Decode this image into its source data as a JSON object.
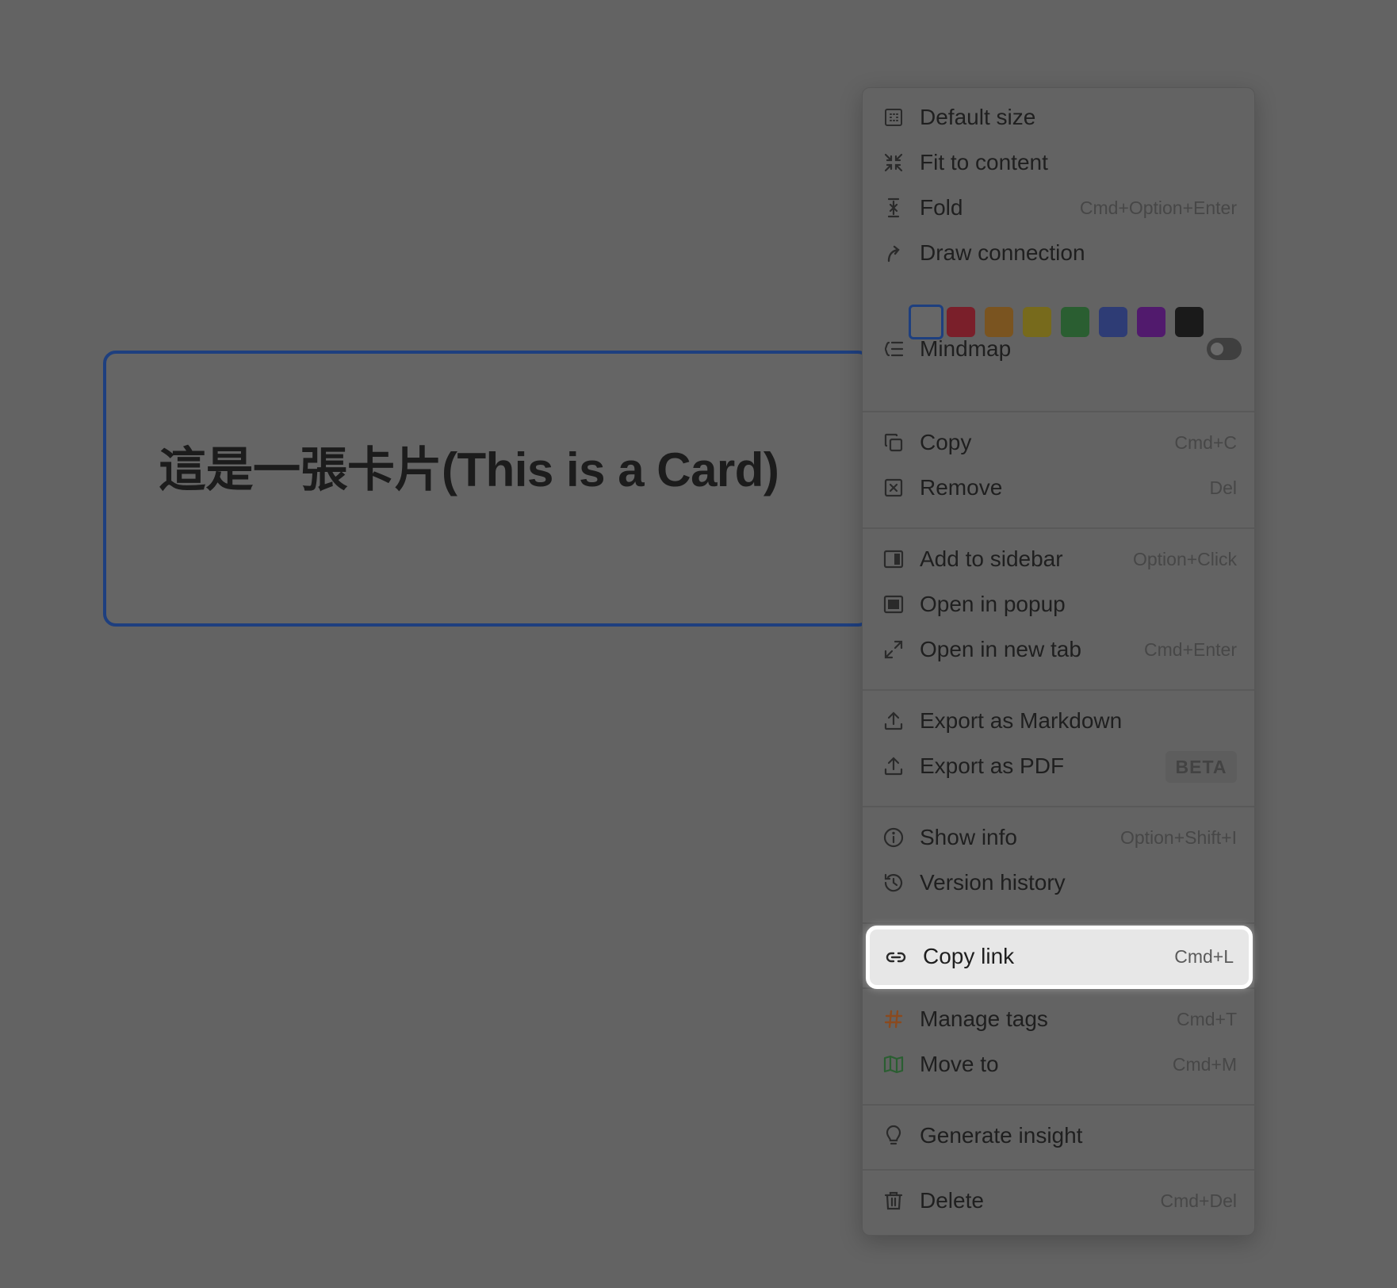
{
  "card": {
    "title": "這是一張卡片(This is a Card)"
  },
  "menu": {
    "default_size": {
      "label": "Default size",
      "icon": "grid-size-icon"
    },
    "fit_to_content": {
      "label": "Fit to content",
      "icon": "compress-icon"
    },
    "fold": {
      "label": "Fold",
      "shortcut": "Cmd+Option+Enter",
      "icon": "fold-icon"
    },
    "draw_connection": {
      "label": "Draw connection",
      "icon": "curved-arrow-icon"
    },
    "colors": [
      "#676767",
      "#7a1f2a",
      "#7a5420",
      "#776a1c",
      "#2a5e31",
      "#2e3c75",
      "#511a6d",
      "#1a1a1a"
    ],
    "selected_color_index": 0,
    "mindmap": {
      "label": "Mindmap",
      "icon": "mindmap-icon",
      "enabled": false
    },
    "copy": {
      "label": "Copy",
      "shortcut": "Cmd+C",
      "icon": "copy-icon"
    },
    "remove": {
      "label": "Remove",
      "shortcut": "Del",
      "icon": "remove-box-icon"
    },
    "add_to_sidebar": {
      "label": "Add to sidebar",
      "shortcut": "Option+Click",
      "icon": "sidebar-icon"
    },
    "open_in_popup": {
      "label": "Open in popup",
      "icon": "popup-icon"
    },
    "open_in_new_tab": {
      "label": "Open in new tab",
      "shortcut": "Cmd+Enter",
      "icon": "expand-icon"
    },
    "export_markdown": {
      "label": "Export as Markdown",
      "icon": "upload-icon"
    },
    "export_pdf": {
      "label": "Export as PDF",
      "badge": "BETA",
      "icon": "upload-icon"
    },
    "show_info": {
      "label": "Show info",
      "shortcut": "Option+Shift+I",
      "icon": "info-icon"
    },
    "version_history": {
      "label": "Version history",
      "icon": "history-icon"
    },
    "copy_link": {
      "label": "Copy link",
      "shortcut": "Cmd+L",
      "icon": "link-icon"
    },
    "manage_tags": {
      "label": "Manage tags",
      "shortcut": "Cmd+T",
      "icon": "hash-icon",
      "icon_color": "#8a4a1f"
    },
    "move_to": {
      "label": "Move to",
      "shortcut": "Cmd+M",
      "icon": "map-icon",
      "icon_color": "#2a5e31"
    },
    "generate_insight": {
      "label": "Generate insight",
      "icon": "lightbulb-icon"
    },
    "delete": {
      "label": "Delete",
      "shortcut": "Cmd+Del",
      "icon": "trash-icon"
    }
  }
}
